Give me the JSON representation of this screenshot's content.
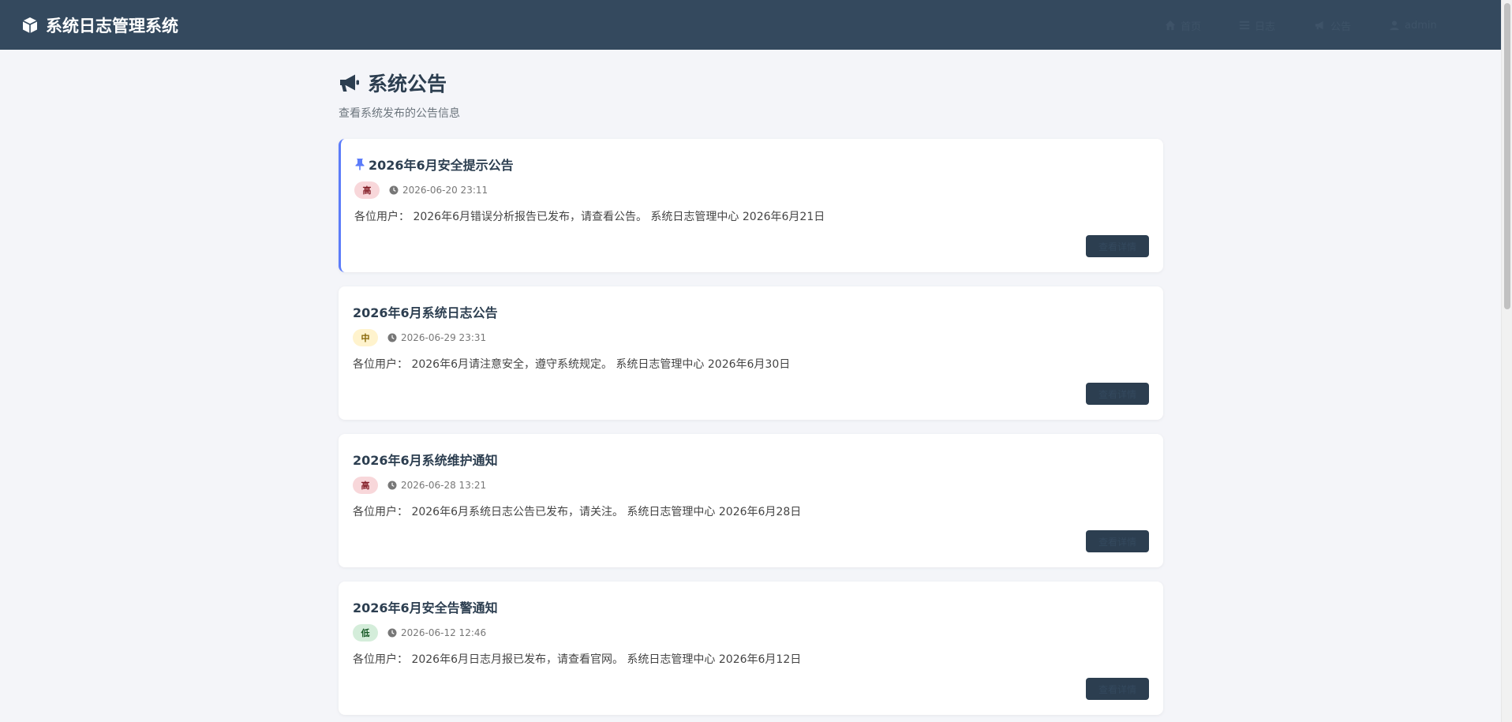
{
  "app": {
    "title": "系统日志管理系统"
  },
  "nav": {
    "items": [
      {
        "label": "首页",
        "icon": "home-icon"
      },
      {
        "label": "日志",
        "icon": "list-icon"
      },
      {
        "label": "公告",
        "icon": "megaphone-icon"
      },
      {
        "label": "admin",
        "icon": "user-icon"
      }
    ]
  },
  "page": {
    "title": "系统公告",
    "subtitle": "查看系统发布的公告信息"
  },
  "notices": [
    {
      "title": "2026年6月安全提示公告",
      "pinned": true,
      "priority": "高",
      "priority_level": "high",
      "time": "2026-06-20 23:11",
      "content": "各位用户： 2026年6月错误分析报告已发布，请查看公告。 系统日志管理中心 2026年6月21日",
      "button": "查看详情"
    },
    {
      "title": "2026年6月系统日志公告",
      "pinned": false,
      "priority": "中",
      "priority_level": "mid",
      "time": "2026-06-29 23:31",
      "content": "各位用户： 2026年6月请注意安全，遵守系统规定。 系统日志管理中心 2026年6月30日",
      "button": "查看详情"
    },
    {
      "title": "2026年6月系统维护通知",
      "pinned": false,
      "priority": "高",
      "priority_level": "high",
      "time": "2026-06-28 13:21",
      "content": "各位用户： 2026年6月系统日志公告已发布，请关注。 系统日志管理中心 2026年6月28日",
      "button": "查看详情"
    },
    {
      "title": "2026年6月安全告警通知",
      "pinned": false,
      "priority": "低",
      "priority_level": "low",
      "time": "2026-06-12 12:46",
      "content": "各位用户： 2026年6月日志月报已发布，请查看官网。 系统日志管理中心 2026年6月12日",
      "button": "查看详情"
    }
  ]
}
